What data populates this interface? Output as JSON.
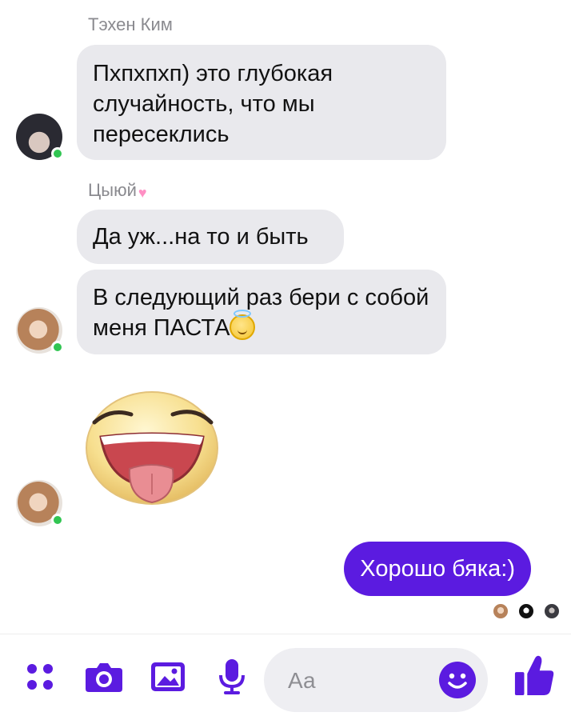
{
  "messages": {
    "group1": {
      "sender": "Тэхен Ким",
      "text": "Пхпхпхп)  это глубокая случайность, что мы пересеклись"
    },
    "group2": {
      "sender": "Цыюй",
      "sender_suffix_icon": "pink-heart",
      "message1": "Да уж...на то и быть",
      "message2": "В следующий раз бери с собой меня ПАСТА",
      "message2_emoji": "smiling-face-with-halo",
      "sticker": "tongue-out-laughing-sticker"
    },
    "outgoing": {
      "text": "Хорошо бяка:)"
    }
  },
  "composer": {
    "placeholder": "Аа"
  },
  "colors": {
    "accent": "#5b1be0",
    "incoming_bubble": "#e9e9ed",
    "online_dot": "#31c552"
  },
  "icons": {
    "menu": "four-dots-icon",
    "camera": "camera-icon",
    "gallery": "image-icon",
    "voice": "microphone-icon",
    "emoji": "smiley-icon",
    "like": "thumbs-up-icon"
  }
}
